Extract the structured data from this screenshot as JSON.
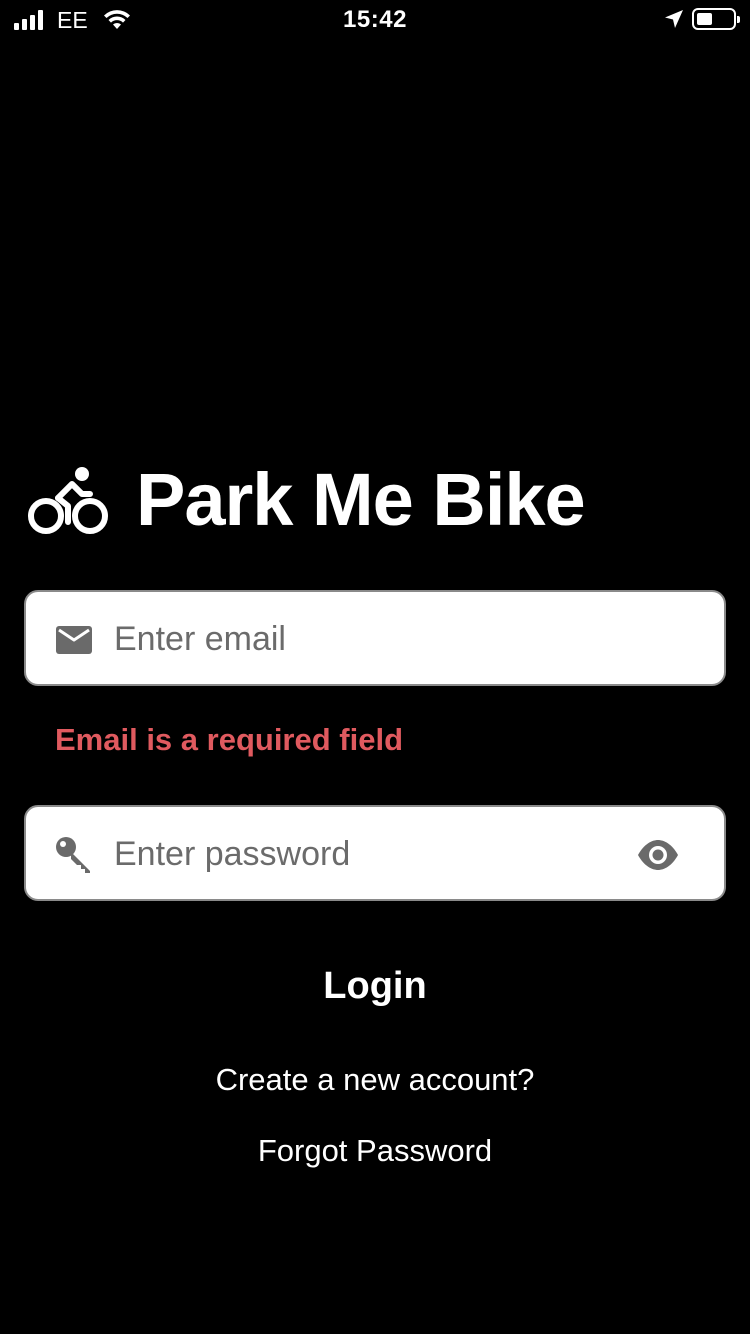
{
  "status_bar": {
    "carrier": "EE",
    "time": "15:42",
    "battery_level": 0.45
  },
  "brand": {
    "title": "Park Me Bike",
    "icon": "bicycle-rider-icon"
  },
  "email": {
    "placeholder": "Enter email",
    "value": "",
    "icon": "mail-icon",
    "error": "Email is a required field"
  },
  "password": {
    "placeholder": "Enter password",
    "value": "",
    "icon": "key-icon",
    "toggle_icon": "eye-icon"
  },
  "actions": {
    "login_label": "Login",
    "create_account_label": "Create a new account?",
    "forgot_password_label": "Forgot Password"
  },
  "colors": {
    "background": "#000000",
    "error": "#e05a5f",
    "field_background": "#ffffff"
  }
}
